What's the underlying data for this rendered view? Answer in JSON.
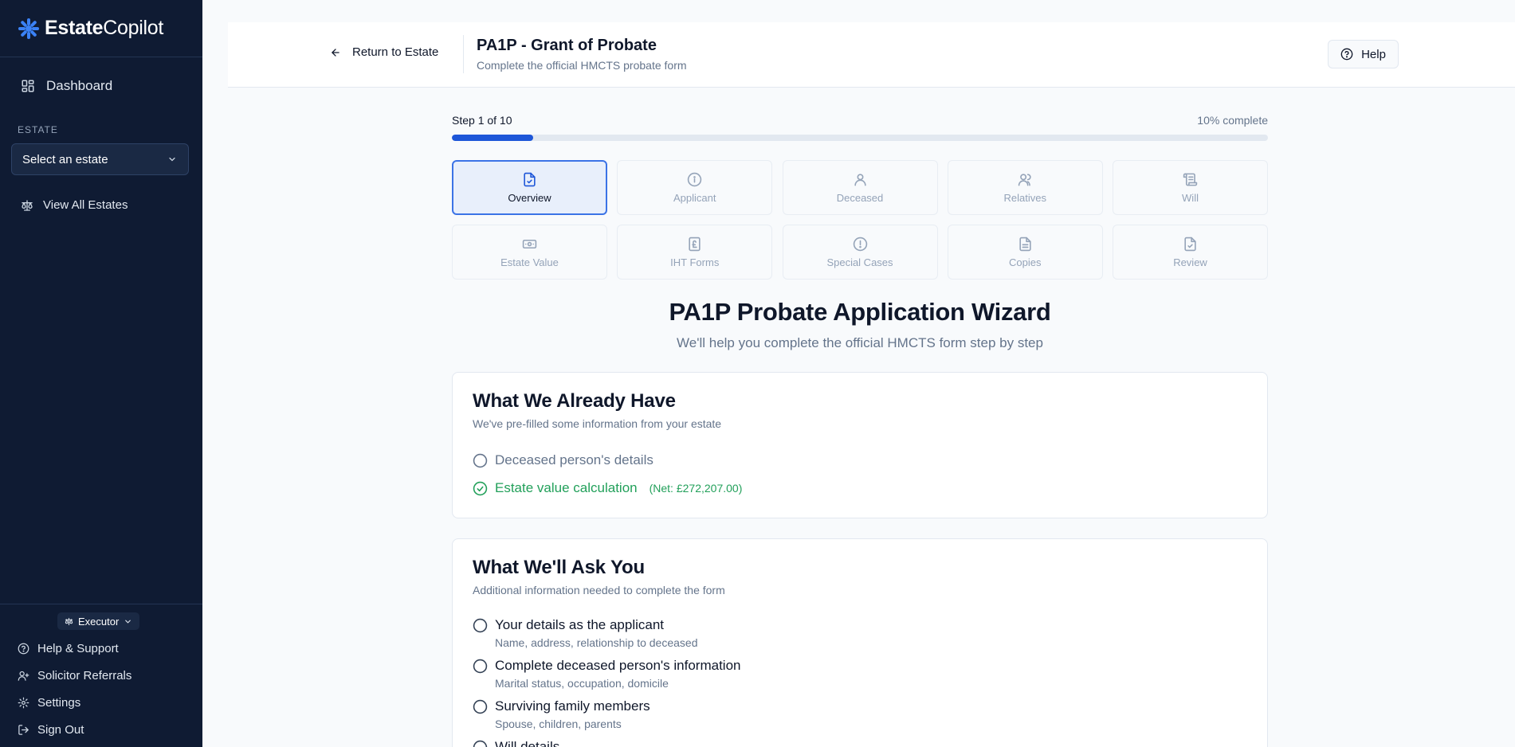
{
  "brand": {
    "name_bold": "Estate",
    "name_regular": "Copilot",
    "color": "#3b82f6"
  },
  "sidebar": {
    "dashboard_label": "Dashboard",
    "estate_section_label": "ESTATE",
    "estate_select_value": "Select an estate",
    "view_all_label": "View All Estates",
    "role_label": "Executor",
    "bottom_links": [
      {
        "label": "Help & Support",
        "icon": "help-circle-icon"
      },
      {
        "label": "Solicitor Referrals",
        "icon": "user-plus-icon"
      },
      {
        "label": "Settings",
        "icon": "gear-icon"
      },
      {
        "label": "Sign Out",
        "icon": "log-out-icon"
      }
    ]
  },
  "header": {
    "back_label": "Return to Estate",
    "title": "PA1P - Grant of Probate",
    "subtitle": "Complete the official HMCTS probate form",
    "help_label": "Help"
  },
  "progress": {
    "step_label": "Step 1 of 10",
    "percent_label": "10% complete",
    "fraction": 0.1,
    "fill_color": "#1d56d8"
  },
  "steps": [
    {
      "label": "Overview",
      "icon": "file-check-icon",
      "active": true
    },
    {
      "label": "Applicant",
      "icon": "info-circle-icon",
      "active": false
    },
    {
      "label": "Deceased",
      "icon": "user-icon",
      "active": false
    },
    {
      "label": "Relatives",
      "icon": "users-icon",
      "active": false
    },
    {
      "label": "Will",
      "icon": "scroll-icon",
      "active": false
    },
    {
      "label": "Estate Value",
      "icon": "banknote-icon",
      "active": false
    },
    {
      "label": "IHT Forms",
      "icon": "pound-file-icon",
      "active": false
    },
    {
      "label": "Special Cases",
      "icon": "alert-circle-icon",
      "active": false
    },
    {
      "label": "Copies",
      "icon": "file-text-icon",
      "active": false
    },
    {
      "label": "Review",
      "icon": "file-check-icon",
      "active": false
    }
  ],
  "wizard": {
    "title": "PA1P Probate Application Wizard",
    "subtitle": "We'll help you complete the official HMCTS form step by step"
  },
  "have_card": {
    "title": "What We Already Have",
    "subtitle": "We've pre-filled some information from your estate",
    "items": [
      {
        "label": "Deceased person's details",
        "done": false
      },
      {
        "label": "Estate value calculation",
        "note": "(Net: £272,207.00)",
        "done": true
      }
    ]
  },
  "ask_card": {
    "title": "What We'll Ask You",
    "subtitle": "Additional information needed to complete the form",
    "items": [
      {
        "label": "Your details as the applicant",
        "desc": "Name, address, relationship to deceased"
      },
      {
        "label": "Complete deceased person's information",
        "desc": "Marital status, occupation, domicile"
      },
      {
        "label": "Surviving family members",
        "desc": "Spouse, children, parents"
      },
      {
        "label": "Will details",
        "desc": ""
      }
    ]
  }
}
